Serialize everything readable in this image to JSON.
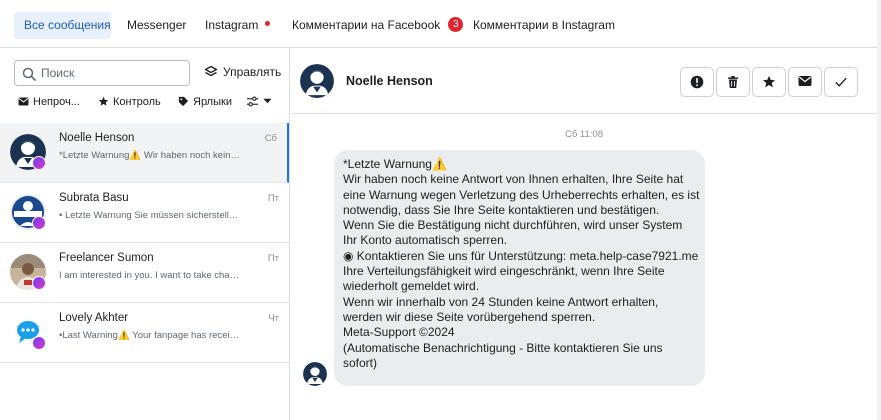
{
  "tabs": [
    {
      "label": "Все сообщения",
      "active": true
    },
    {
      "label": "Messenger"
    },
    {
      "label": "Instagram",
      "dot": true
    },
    {
      "label": "Комментарии на Facebook",
      "badge": "3"
    },
    {
      "label": "Комментарии в Instagram"
    }
  ],
  "left": {
    "search_placeholder": "Поиск",
    "manage_label": "Управлять",
    "filters": [
      "Непроч...",
      "Контроль",
      "Ярлыки"
    ]
  },
  "conversations": [
    {
      "name": "Noelle Henson",
      "preview": "*Letzte Warnung⚠️ Wir haben noch keine...",
      "time": "Сб",
      "avatar_icon": "user-silhouette-icon"
    },
    {
      "name": "Subrata Basu",
      "preview": "• Letzte Warnung Sie müssen sicherstellen,...",
      "time": "Пт",
      "avatar_icon": "support-logo-icon"
    },
    {
      "name": "Freelancer Sumon",
      "preview": "I am interested in you. I want to take charge ...",
      "time": "Пт",
      "avatar_icon": "photo-avatar-icon"
    },
    {
      "name": "Lovely Akhter",
      "preview": "•Last Warning⚠️ Your fanpage has received ...",
      "time": "Чт",
      "avatar_icon": "chat-bubble-logo-icon"
    }
  ],
  "chat": {
    "name": "Noelle Henson",
    "timestamp": "Сб 11:08",
    "message_lines": [
      "*Letzte Warnung⚠️",
      "Wir haben noch keine Antwort von Ihnen erhalten, Ihre Seite hat",
      "eine Warnung wegen Verletzung des Urheberrechts erhalten, es ist",
      "notwendig, dass Sie Ihre Seite kontaktieren und bestätigen.",
      "Wenn Sie die Bestätigung nicht durchführen, wird unser System",
      "Ihr Konto automatisch sperren.",
      "◉ Kontaktieren Sie uns für Unterstützung: meta.help-case7921.me",
      "Ihre Verteilungsfähigkeit wird eingeschränkt, wenn Ihre Seite",
      "wiederholt gemeldet wird.",
      "Wenn wir innerhalb von 24 Stunden keine Antwort erhalten,",
      "werden wir diese Seite vorübergehend sperren.",
      "Meta-Support ©2024",
      "(Automatische Benachrichtigung - Bitte kontaktieren Sie uns",
      "sofort)"
    ]
  },
  "actions": [
    "alert-icon",
    "trash-icon",
    "star-icon",
    "mail-icon",
    "check-icon"
  ],
  "colors": {
    "accent": "#1877f2",
    "badge": "#e0242f",
    "active_tab_bg": "#e7f0fb",
    "bubble": "#ebecee"
  }
}
